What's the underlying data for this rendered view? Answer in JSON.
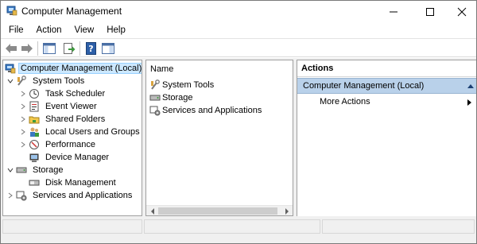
{
  "window": {
    "title": "Computer Management",
    "controls": [
      "minimize",
      "maximize",
      "close"
    ]
  },
  "menu": [
    "File",
    "Action",
    "View",
    "Help"
  ],
  "toolbar": {
    "buttons": [
      "back-arrow-icon",
      "forward-arrow-icon",
      "show-hide-console-tree-icon",
      "export-list-icon",
      "help-icon",
      "show-hide-action-pane-icon"
    ]
  },
  "tree": {
    "root": "Computer Management (Local)",
    "system_tools": "System Tools",
    "task_scheduler": "Task Scheduler",
    "event_viewer": "Event Viewer",
    "shared_folders": "Shared Folders",
    "local_users": "Local Users and Groups",
    "performance": "Performance",
    "device_manager": "Device Manager",
    "storage": "Storage",
    "disk_management": "Disk Management",
    "services_apps": "Services and Applications"
  },
  "list": {
    "column_name": "Name",
    "items": [
      "System Tools",
      "Storage",
      "Services and Applications"
    ]
  },
  "actions": {
    "header": "Actions",
    "section": "Computer Management (Local)",
    "more_actions": "More Actions"
  },
  "colors": {
    "selection": "#cce8ff",
    "actions_section_bg": "#b9d1ea"
  }
}
